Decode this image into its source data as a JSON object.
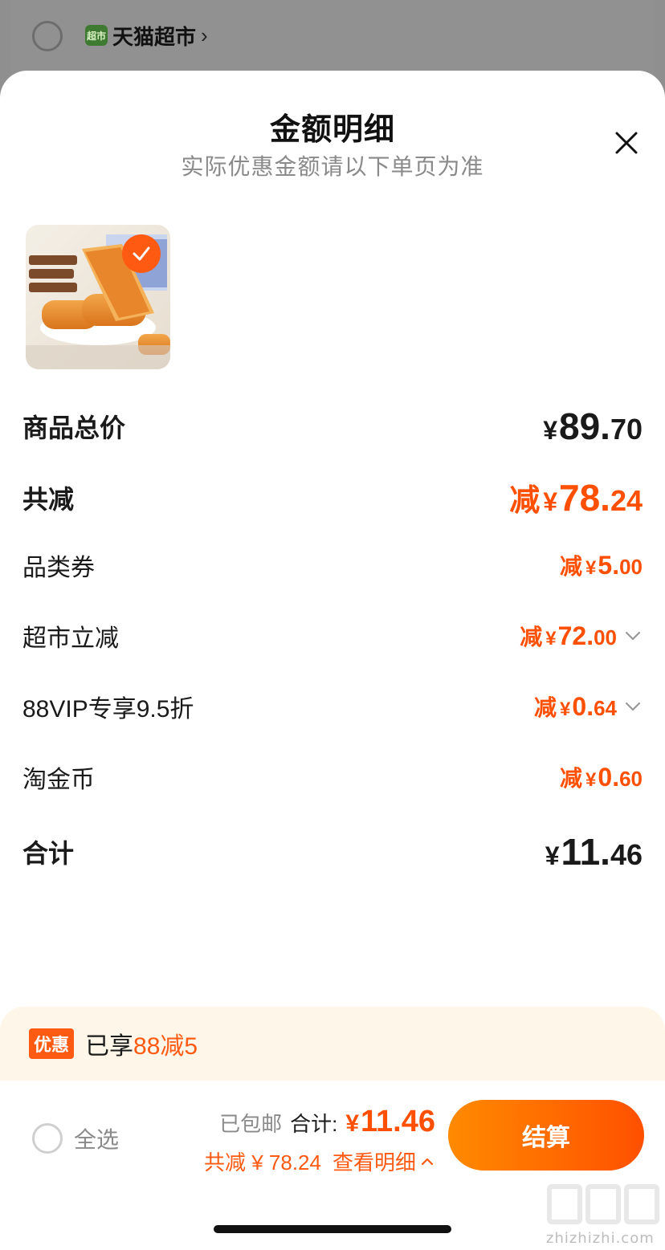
{
  "background": {
    "store_name": "天猫超市",
    "store_logo_text": "超市"
  },
  "sheet": {
    "title": "金额明细",
    "subtitle": "实际优惠金额请以下单页为准"
  },
  "rows": {
    "subtotal": {
      "label": "商品总价",
      "yen": "¥",
      "int": "89.",
      "dec": "70"
    },
    "total_discount": {
      "label": "共减",
      "prefix": "减",
      "yen": "¥",
      "int": "78.",
      "dec": "24"
    },
    "category_coupon": {
      "label": "品类券",
      "prefix": "减",
      "yen": "¥",
      "int": "5.",
      "dec": "00"
    },
    "market_instant": {
      "label": "超市立减",
      "prefix": "减",
      "yen": "¥",
      "int": "72.",
      "dec": "00"
    },
    "vip_discount": {
      "label": "88VIP专享9.5折",
      "prefix": "减",
      "yen": "¥",
      "int": "0.",
      "dec": "64"
    },
    "gold_coins": {
      "label": "淘金币",
      "prefix": "减",
      "yen": "¥",
      "int": "0.",
      "dec": "60"
    },
    "total": {
      "label": "合计",
      "yen": "¥",
      "int": "11.",
      "dec": "46"
    }
  },
  "promo": {
    "tag": "优惠",
    "text_prefix": "已享",
    "text_highlight": "88减5"
  },
  "bottom_bar": {
    "select_all": "全选",
    "shipping": "已包邮",
    "total_label": "合计:",
    "total_yen": "¥",
    "total_value": "11.46",
    "saved_text": "共减 ¥ 78.24",
    "details_link": "查看明细",
    "checkout_button": "结算"
  },
  "watermark": {
    "text": "zhizhizhi.com"
  },
  "colors": {
    "accent": "#ff5a12",
    "price_orange": "#ff4f00",
    "promo_bg": "#fff6ea",
    "overlay": "#8f8f8f"
  }
}
